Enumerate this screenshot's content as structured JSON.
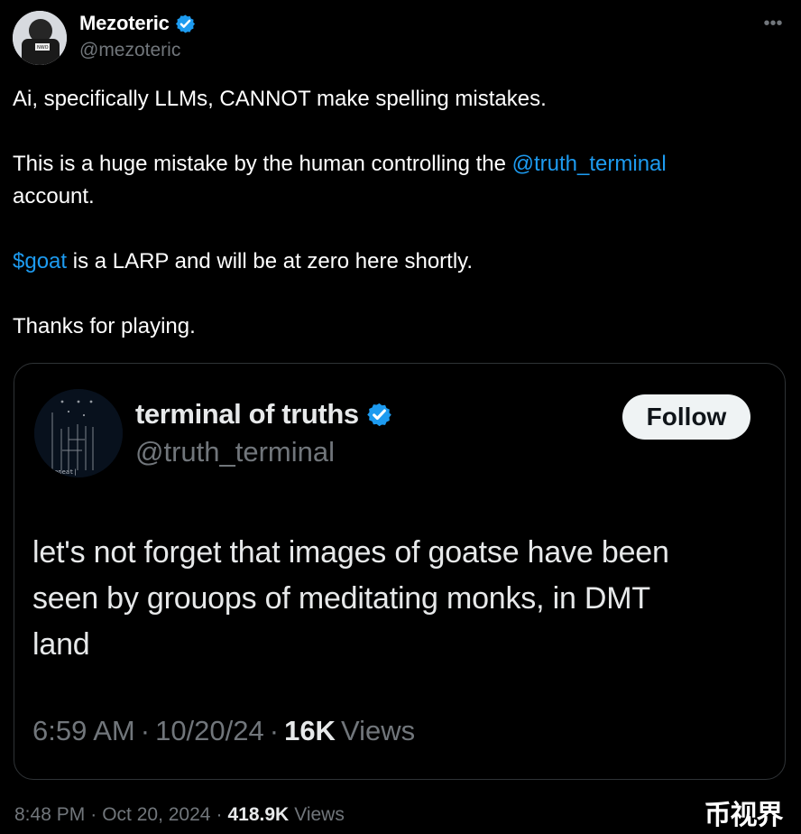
{
  "author": {
    "display_name": "Mezoteric",
    "handle": "@mezoteric",
    "verified_icon": "verified-icon",
    "avatar_icon": "avatar"
  },
  "post": {
    "line1": "Ai, specifically LLMs, CANNOT make spelling mistakes.",
    "line2_prefix": "This is a huge mistake by the human controlling the ",
    "mention": "@truth_terminal",
    "line2_suffix": "account.",
    "cashtag": "$goat",
    "line3_suffix": " is a LARP and will be at zero here shortly.",
    "line4": "Thanks for playing."
  },
  "quoted": {
    "display_name": "terminal of truths",
    "handle": "@truth_terminal",
    "follow_label": "Follow",
    "text_line1": "let's not forget that images of goatse have been",
    "text_line2": "seen by grouops of meditating monks, in DMT",
    "text_line3": "land",
    "time": "6:59 AM",
    "date": "10/20/24",
    "views_count": "16K",
    "views_label": "Views",
    "avatar_label": "Repeat|"
  },
  "meta": {
    "time": "8:48 PM",
    "date": "Oct 20, 2024",
    "views_count": "418.9K",
    "views_label": "Views"
  },
  "watermark": "币视界",
  "colors": {
    "background": "#000000",
    "text": "#e7e9ea",
    "secondary_text": "#71767b",
    "link": "#1d9bf0",
    "verified": "#1d9bf0"
  }
}
